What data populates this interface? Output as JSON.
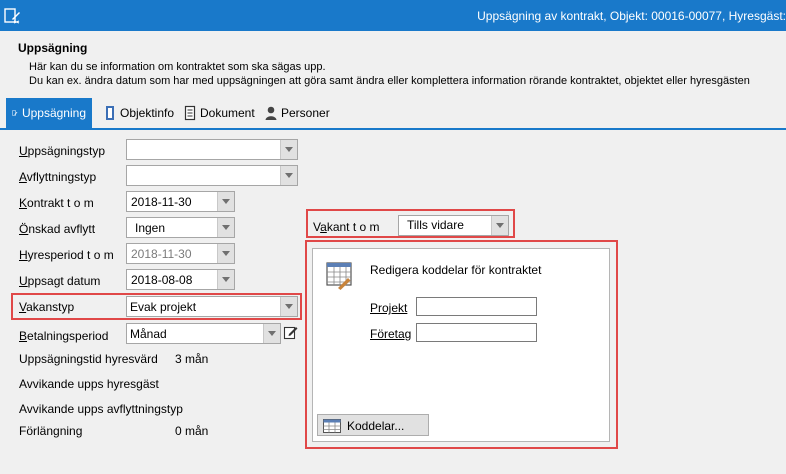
{
  "window": {
    "title": "Uppsägning av kontrakt, Objekt: 00016-00077, Hyresgäst:"
  },
  "header": {
    "title": "Uppsägning",
    "line1": "Här kan du se information om kontraktet som ska sägas upp.",
    "line2": "Du kan ex. ändra datum som har med uppsägningen att göra samt ändra eller komplettera information rörande kontraktet, objektet eller hyresgästen"
  },
  "tabs": [
    {
      "label": "Uppsägning",
      "icon": "edit-doc-icon",
      "active": true
    },
    {
      "label": "Objektinfo",
      "icon": "door-icon",
      "active": false
    },
    {
      "label": "Dokument",
      "icon": "document-icon",
      "active": false
    },
    {
      "label": "Personer",
      "icon": "person-icon",
      "active": false
    }
  ],
  "form": {
    "uppsagningstyp": {
      "label_u": "U",
      "label_rest": "ppsägningstyp",
      "value": ""
    },
    "avflyttningstyp": {
      "label_u": "A",
      "label_rest": "vflyttningstyp",
      "value": ""
    },
    "kontrakt_tom": {
      "label_u": "K",
      "label_rest": "ontrakt t o m",
      "value": "2018-11-30"
    },
    "onskad_avflytt": {
      "label_u": "Ö",
      "label_rest": "nskad avflytt",
      "value": "Ingen"
    },
    "hyresperiod_tom": {
      "label_u": "H",
      "label_rest": "yresperiod t o m",
      "value": "2018-11-30"
    },
    "uppsagt_datum": {
      "label_u": "U",
      "label_rest": "ppsagt datum",
      "value": "2018-08-08"
    },
    "vakanstyp": {
      "label_u": "V",
      "label_rest": "akanstyp",
      "value": "Evak projekt"
    },
    "betalningsperiod": {
      "label_u": "B",
      "label_rest": "etalningsperiod",
      "value": "Månad"
    },
    "uppsagningstid": {
      "label": "Uppsägningstid hyresvärd",
      "value": "3 mån"
    },
    "avvikande_hyresgast": {
      "label": "Avvikande upps hyresgäst"
    },
    "avvikande_avflyttningstyp": {
      "label": "Avvikande upps avflyttningstyp"
    },
    "forlangning": {
      "label": "Förlängning",
      "value": "0 mån"
    }
  },
  "vakant": {
    "label_pre": "V",
    "label_u": "a",
    "label_rest": "kant t o m",
    "value": "Tills vidare"
  },
  "koddelar": {
    "title": "Redigera koddelar för kontraktet",
    "projekt_label": "Projekt",
    "projekt_value": "",
    "foretag_label": "Företag",
    "foretag_value": "",
    "button_label": "Koddelar..."
  },
  "colors": {
    "accent": "#1979ca",
    "highlight": "#e04848"
  }
}
